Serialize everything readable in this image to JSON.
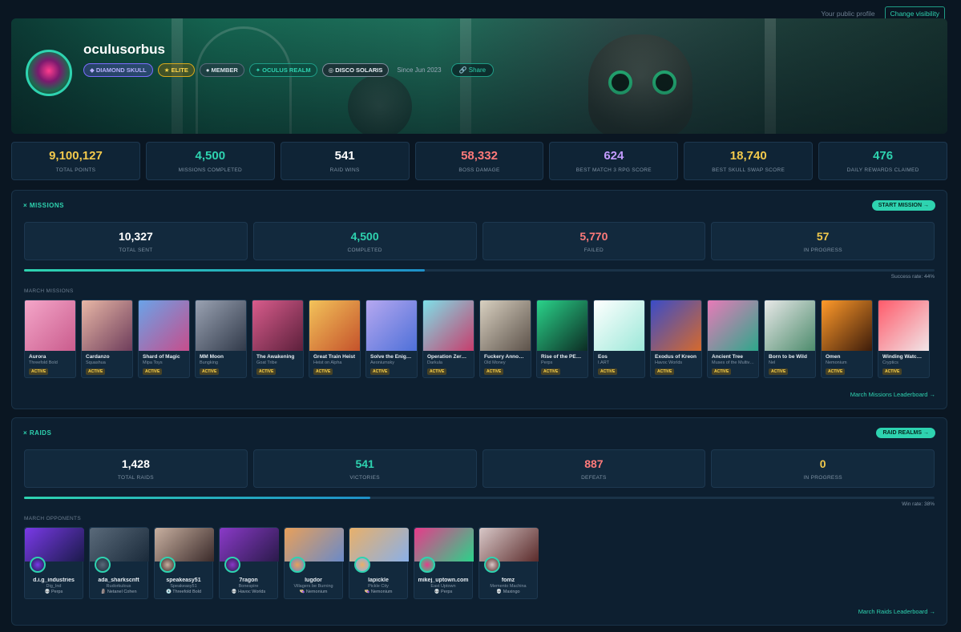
{
  "topbar": {
    "public_label": "Your public profile",
    "visibility_button": "Change visibility"
  },
  "profile": {
    "username": "oculusorbus",
    "badges": [
      "◆ DIAMOND SKULL",
      "★ ELITE",
      "● MEMBER",
      "✦ OCULUS REALM",
      "◎ DISCO SOLARIS"
    ],
    "since": "Since Jun 2023",
    "share": "Share"
  },
  "stats": [
    {
      "value": "9,100,127",
      "label": "TOTAL POINTS",
      "color": "#f2c94c"
    },
    {
      "value": "4,500",
      "label": "MISSIONS COMPLETED",
      "color": "#2ed3b0"
    },
    {
      "value": "541",
      "label": "RAID WINS",
      "color": "#ffffff"
    },
    {
      "value": "58,332",
      "label": "BOSS DAMAGE",
      "color": "#ff7a7a"
    },
    {
      "value": "624",
      "label": "BEST MATCH 3 RPG SCORE",
      "color": "#c39bff"
    },
    {
      "value": "18,740",
      "label": "BEST SKULL SWAP SCORE",
      "color": "#f2c94c"
    },
    {
      "value": "476",
      "label": "DAILY REWARDS CLAIMED",
      "color": "#2ed3b0"
    }
  ],
  "missions": {
    "title": "× MISSIONS",
    "button": "START MISSION →",
    "kpis": [
      {
        "value": "10,327",
        "label": "TOTAL SENT",
        "color": "#ffffff"
      },
      {
        "value": "4,500",
        "label": "COMPLETED",
        "color": "#2ed3b0"
      },
      {
        "value": "5,770",
        "label": "FAILED",
        "color": "#ff7a7a"
      },
      {
        "value": "57",
        "label": "IN PROGRESS",
        "color": "#f2c94c"
      }
    ],
    "success_rate": "Success rate: 44%",
    "success_fraction": 0.44,
    "section_label": "MARCH MISSIONS",
    "cards": [
      {
        "title": "Aurora",
        "sub": "Threefold Bold",
        "status": "ACTIVE",
        "colors": [
          "#f4a6c9",
          "#c95b8c"
        ]
      },
      {
        "title": "Cardanzo",
        "sub": "Squashua",
        "status": "ACTIVE",
        "colors": [
          "#e8b7a6",
          "#6c3b5a"
        ]
      },
      {
        "title": "Shard of Magic",
        "sub": "Mipa Toys",
        "status": "ACTIVE",
        "colors": [
          "#6aa3e8",
          "#c84c8a"
        ]
      },
      {
        "title": "MM Moon",
        "sub": "Bungking",
        "status": "ACTIVE",
        "colors": [
          "#9aa2b2",
          "#2f3848"
        ]
      },
      {
        "title": "The Awakening",
        "sub": "Goat Tribe",
        "status": "ACTIVE",
        "colors": [
          "#d85c8c",
          "#5a1f3a"
        ]
      },
      {
        "title": "Great Train Heist",
        "sub": "Heist on Alpha",
        "status": "ACTIVE",
        "colors": [
          "#f3c35a",
          "#c4502a"
        ]
      },
      {
        "title": "Solve the Enigma",
        "sub": "Aeoniumsky",
        "status": "ACTIVE",
        "colors": [
          "#b6a8f0",
          "#4c6fd8"
        ]
      },
      {
        "title": "Operation Zero Sec",
        "sub": "Darkula",
        "status": "ACTIVE",
        "colors": [
          "#7ee0e8",
          "#c83a6a"
        ]
      },
      {
        "title": "Fuckery Announced",
        "sub": "Old Money",
        "status": "ACTIVE",
        "colors": [
          "#d8d0c0",
          "#5a5048"
        ]
      },
      {
        "title": "Rise of the PERPS",
        "sub": "Perps",
        "status": "ACTIVE",
        "colors": [
          "#2ad38a",
          "#0c2a22"
        ]
      },
      {
        "title": "Eos",
        "sub": "I.ART",
        "status": "ACTIVE",
        "colors": [
          "#ffffff",
          "#9ae8d8"
        ]
      },
      {
        "title": "Exodus of Kreon",
        "sub": "Havoc Worlds",
        "status": "ACTIVE",
        "colors": [
          "#3a4cc8",
          "#d86a2a"
        ]
      },
      {
        "title": "Ancient Tree",
        "sub": "Muses of the Multiverse",
        "status": "ACTIVE",
        "colors": [
          "#e87ab8",
          "#2aa88a"
        ]
      },
      {
        "title": "Born to be Wild",
        "sub": "Nel",
        "status": "ACTIVE",
        "colors": [
          "#e8e8e8",
          "#4a8a6a"
        ]
      },
      {
        "title": "Omen",
        "sub": "Nemonium",
        "status": "ACTIVE",
        "colors": [
          "#ff9a2a",
          "#3a1a0a"
        ]
      },
      {
        "title": "Winding Watchers",
        "sub": "Cryptics",
        "status": "ACTIVE",
        "colors": [
          "#ff5a6a",
          "#f0e8ea"
        ]
      }
    ],
    "leaderboard": "March Missions Leaderboard →"
  },
  "raids": {
    "title": "× RAIDS",
    "button": "RAID REALMS →",
    "kpis": [
      {
        "value": "1,428",
        "label": "TOTAL RAIDS",
        "color": "#ffffff"
      },
      {
        "value": "541",
        "label": "VICTORIES",
        "color": "#2ed3b0"
      },
      {
        "value": "887",
        "label": "DEFEATS",
        "color": "#ff7a7a"
      },
      {
        "value": "0",
        "label": "IN PROGRESS",
        "color": "#f2c94c"
      }
    ],
    "win_rate": "Win rate: 38%",
    "win_fraction": 0.38,
    "section_label": "MARCH OPPONENTS",
    "opponents": [
      {
        "name": "d.i.g_industries",
        "sub": "Dig_Ind",
        "realm": "💀 Perps",
        "colors": [
          "#7a3ae8",
          "#1a1a4a"
        ]
      },
      {
        "name": "ada_sharkscnft",
        "sub": "Rudorkulous",
        "realm": "🗿 Netanel Cohen",
        "colors": [
          "#5a6a7a",
          "#1a2a3a"
        ]
      },
      {
        "name": "speakeasy51",
        "sub": "Speakeasy51",
        "realm": "💿 Threefold Bold",
        "colors": [
          "#c8b0a0",
          "#3a2a2a"
        ]
      },
      {
        "name": "7ragon",
        "sub": "Bonespire",
        "realm": "💀 Havoc Worlds",
        "colors": [
          "#8a3ac8",
          "#2a1a4a"
        ]
      },
      {
        "name": "lugdor",
        "sub": "Villagers be Burning",
        "realm": "👒 Nemonium",
        "colors": [
          "#e8a05a",
          "#6a8ac8"
        ]
      },
      {
        "name": "lapickle",
        "sub": "Pickle City",
        "realm": "👒 Nemonium",
        "colors": [
          "#e8b06a",
          "#8ab0e8"
        ]
      },
      {
        "name": "mikej_uptown.com",
        "sub": "East Uptown",
        "realm": "💀 Perps",
        "colors": [
          "#e83a8a",
          "#2ad38a"
        ]
      },
      {
        "name": "fomz",
        "sub": "Memento Machina",
        "realm": "💀 Maxingo",
        "colors": [
          "#d8c8c8",
          "#5a2a2a"
        ]
      }
    ],
    "leaderboard": "March Raids Leaderboard →"
  }
}
